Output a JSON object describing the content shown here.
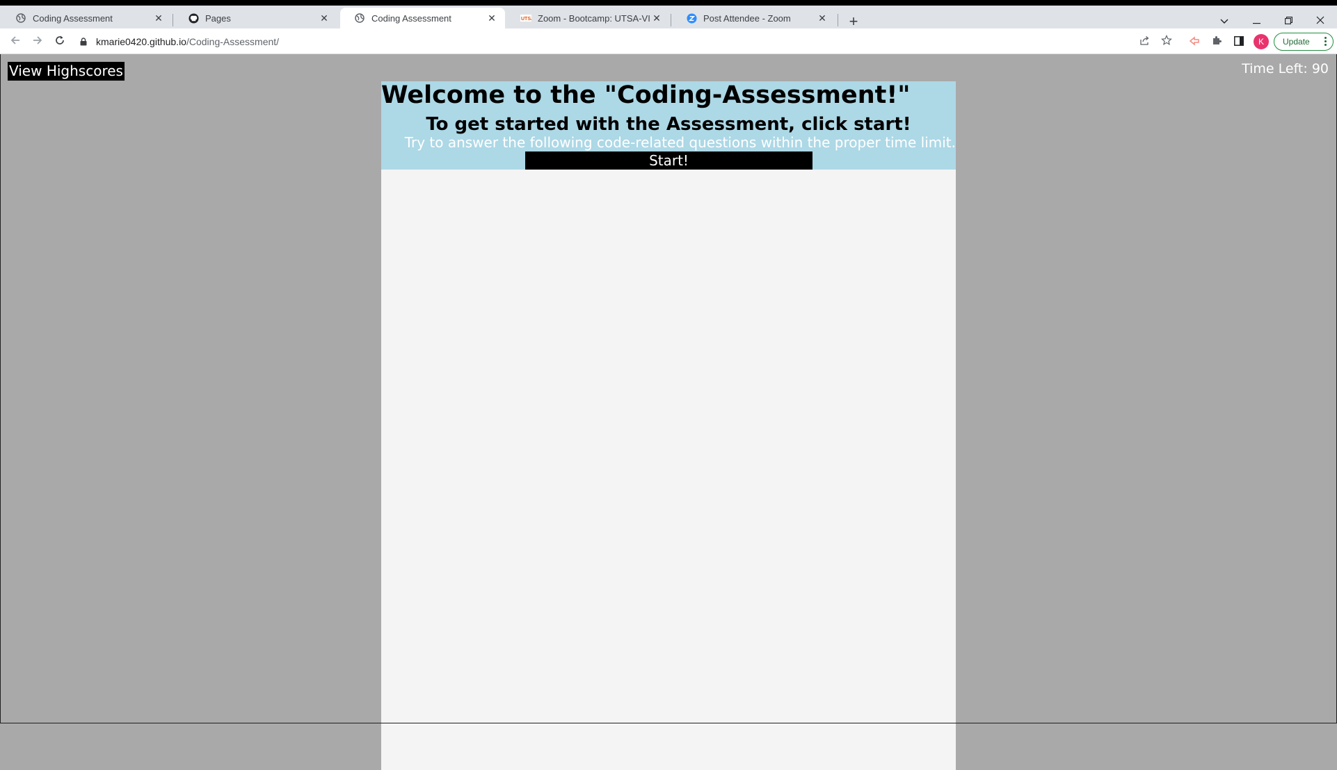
{
  "browser": {
    "tabs": [
      {
        "title": "Coding Assessment",
        "icon": "globe-icon",
        "active": false
      },
      {
        "title": "Pages",
        "icon": "github-icon",
        "active": false
      },
      {
        "title": "Coding Assessment",
        "icon": "globe-icon",
        "active": true
      },
      {
        "title": "Zoom - Bootcamp: UTSA-VIRT-FS",
        "icon": "utsa-icon",
        "active": false
      },
      {
        "title": "Post Attendee - Zoom",
        "icon": "zoom-icon",
        "active": false
      }
    ],
    "close_glyph": "✕",
    "new_tab_glyph": "+",
    "url_host": "kmarie0420.github.io",
    "url_path": "/Coding-Assessment/",
    "profile_initial": "K",
    "update_label": "Update",
    "colors": {
      "profile": "#e8336d",
      "update_border": "#1e8e3e"
    }
  },
  "page": {
    "highscores_label": "View Highscores",
    "timer_text": "Time Left: 90",
    "welcome_title": "Welcome to the \"Coding-Assessment!\"",
    "subheading": "To get started with the Assessment, click start!",
    "instruction": "Try to answer the following code-related questions within the proper time limit.",
    "start_label": "Start!",
    "colors": {
      "background": "#a9a9a9",
      "intro": "#add8e6",
      "panel": "#f4f4f4",
      "button": "#000000"
    }
  }
}
